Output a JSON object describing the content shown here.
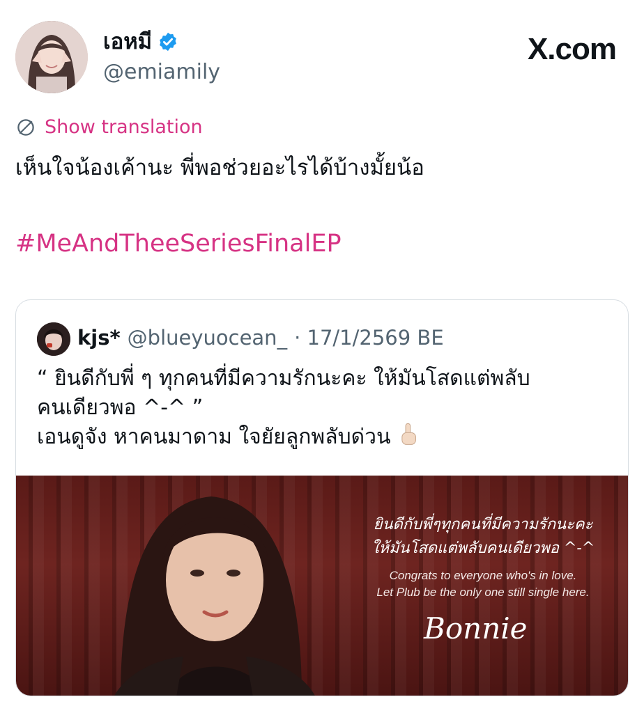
{
  "author": {
    "display_name": "เอหมี",
    "handle": "@emiamily",
    "verified": true
  },
  "brand": {
    "label": "X.com"
  },
  "translation": {
    "label": "Show translation"
  },
  "tweet": {
    "text": "เห็นใจน้องเค้านะ พี่พอช่วยอะไรได้บ้างมั้ยน้อ",
    "hashtag": "#MeAndTheeSeriesFinalEP"
  },
  "quote": {
    "name": "kjs*",
    "handle": "@blueyuocean_",
    "date": "· 17/1/2569 BE",
    "lines": [
      "“ ยินดีกับพี่ ๆ ทุกคนที่มีความรักนะคะ ให้มันโสดแต่พลับ",
      "คนเดียวพอ ^-^ ”",
      "เอนดูจัง หาคนมาดาม ใจยัยลูกพลับด่วน"
    ],
    "emoji": "pointing-up-icon",
    "photo": {
      "thai_line1": "ยินดีกับพี่ๆทุกคนที่มีความรักนะคะ",
      "thai_line2": "ให้มันโสดแต่พลับคนเดียวพอ ^-^",
      "en_line1": "Congrats to everyone who's in love.",
      "en_line2": "Let Plub be the only one still single here.",
      "signature": "Bonnie"
    }
  },
  "colors": {
    "accent": "#d63384",
    "verified": "#1d9bf0",
    "muted": "#536471",
    "curtain": "#5a1a17"
  }
}
